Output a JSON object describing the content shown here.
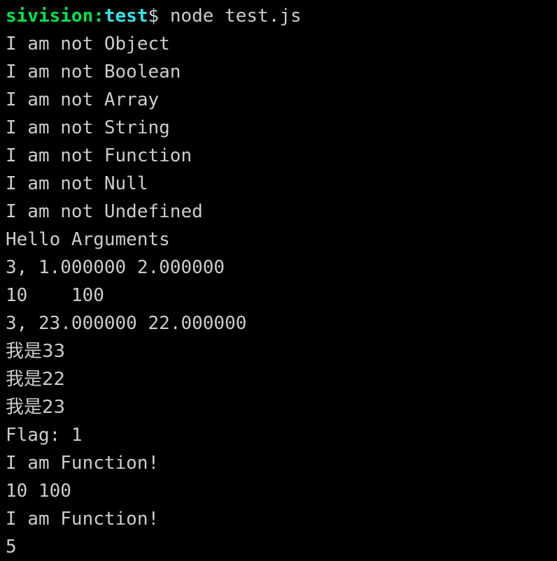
{
  "terminal": {
    "background_color": "#000000",
    "foreground_color": "#cccccc",
    "prompt": {
      "host": "sivision",
      "separator": ":",
      "path": "test",
      "sigil": "$",
      "space": " ",
      "command": "node test.js",
      "host_color": "#00e54d",
      "path_color": "#2ee8e8",
      "sigil_color": "#cccccc",
      "command_color": "#cccccc"
    },
    "output_lines": [
      "I am not Object",
      "I am not Boolean",
      "I am not Array",
      "I am not String",
      "I am not Function",
      "I am not Null",
      "I am not Undefined",
      "Hello Arguments",
      "3, 1.000000 2.000000",
      "10    100",
      "3, 23.000000 22.000000",
      "我是33",
      "我是22",
      "我是23",
      "Flag: 1",
      "I am Function!",
      "10 100",
      "I am Function!",
      "5"
    ]
  }
}
